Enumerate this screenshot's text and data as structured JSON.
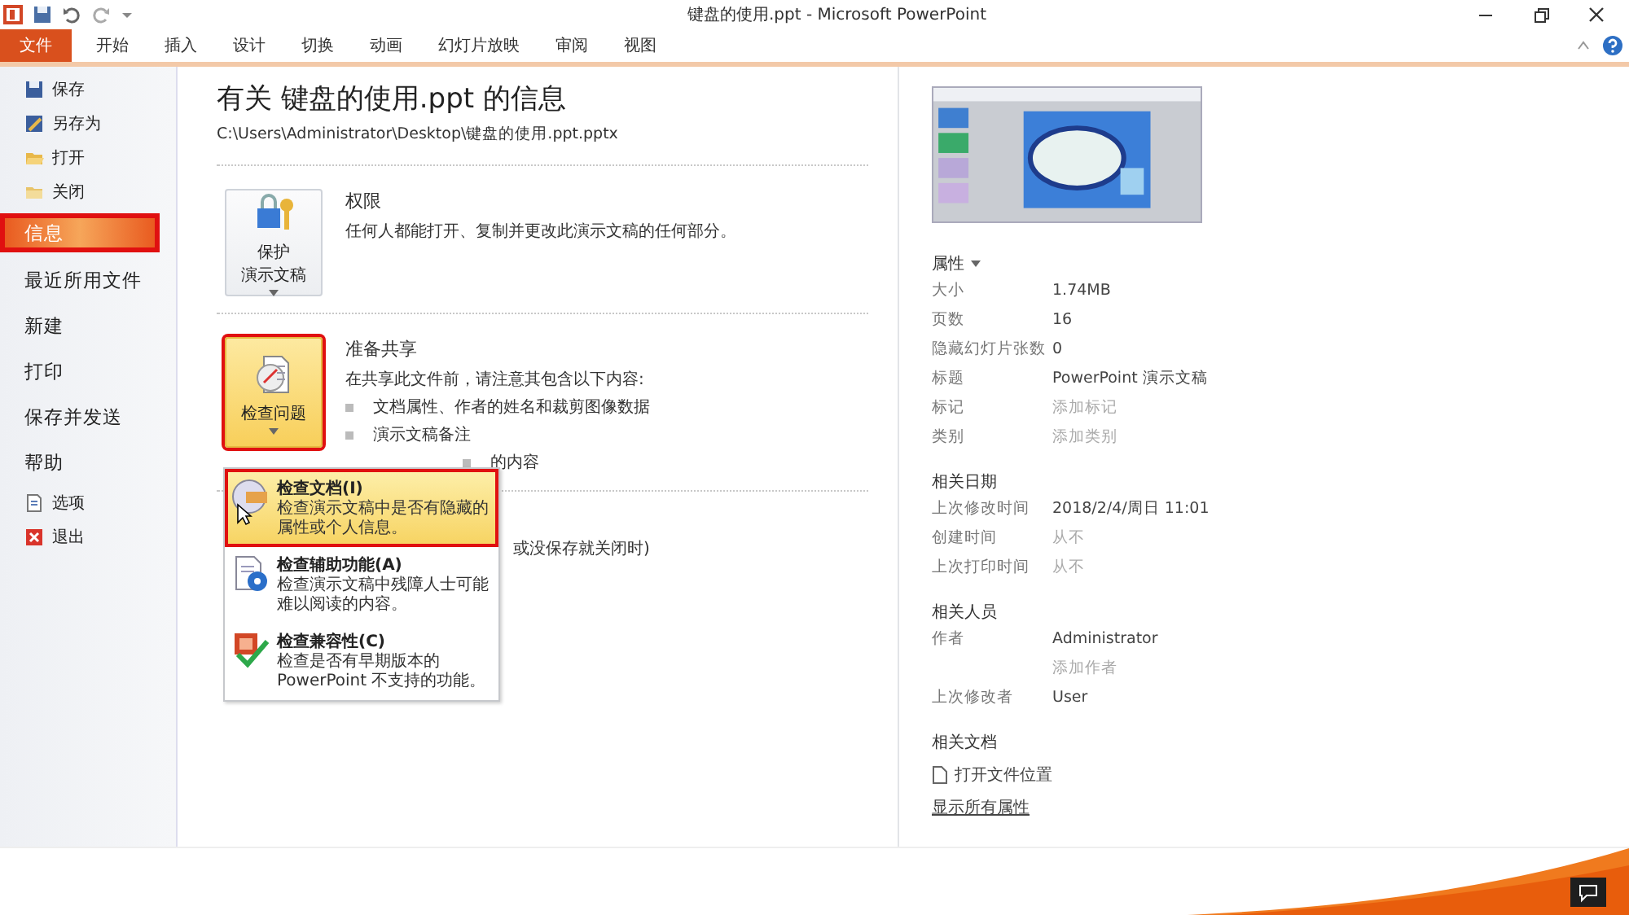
{
  "window": {
    "title": "键盘的使用.ppt - Microsoft PowerPoint"
  },
  "ribbon_tabs": [
    {
      "label": "文件",
      "selected": true
    },
    {
      "label": "开始",
      "selected": false
    },
    {
      "label": "插入",
      "selected": false
    },
    {
      "label": "设计",
      "selected": false
    },
    {
      "label": "切换",
      "selected": false
    },
    {
      "label": "动画",
      "selected": false
    },
    {
      "label": "幻灯片放映",
      "selected": false
    },
    {
      "label": "审阅",
      "selected": false
    },
    {
      "label": "视图",
      "selected": false
    }
  ],
  "backstage_menu": [
    {
      "label": "保存",
      "kind": "command",
      "selected": false,
      "annotated": false
    },
    {
      "label": "另存为",
      "kind": "command",
      "selected": false,
      "annotated": false
    },
    {
      "label": "打开",
      "kind": "command",
      "selected": false,
      "annotated": false
    },
    {
      "label": "关闭",
      "kind": "command",
      "selected": false,
      "annotated": false
    },
    {
      "label": "信息",
      "kind": "page",
      "selected": true,
      "annotated": true
    },
    {
      "label": "最近所用文件",
      "kind": "page",
      "selected": false,
      "annotated": false
    },
    {
      "label": "新建",
      "kind": "page",
      "selected": false,
      "annotated": false
    },
    {
      "label": "打印",
      "kind": "page",
      "selected": false,
      "annotated": false
    },
    {
      "label": "保存并发送",
      "kind": "page",
      "selected": false,
      "annotated": false
    },
    {
      "label": "帮助",
      "kind": "page",
      "selected": false,
      "annotated": false
    },
    {
      "label": "选项",
      "kind": "command",
      "selected": false,
      "annotated": false
    },
    {
      "label": "退出",
      "kind": "command",
      "selected": false,
      "annotated": false
    }
  ],
  "info": {
    "title": "有关 键盘的使用.ppt 的信息",
    "path": "C:\\Users\\Administrator\\Desktop\\键盘的使用.ppt.pptx",
    "sections": [
      {
        "button": {
          "label_lines": [
            "保护",
            "演示文稿"
          ],
          "pressed": false,
          "annotated": false
        },
        "heading": "权限",
        "description": "任何人都能打开、复制并更改此演示文稿的任何部分。"
      },
      {
        "button": {
          "label_lines": [
            "检查问题"
          ],
          "pressed": true,
          "annotated": true
        },
        "heading": "准备共享",
        "description": "在共享此文件前，请注意其包含以下内容:",
        "bullets": [
          "文档属性、作者的姓名和裁剪图像数据",
          "演示文稿备注",
          "的内容"
        ]
      },
      {
        "fragment": "或没保存就关闭时)"
      }
    ]
  },
  "check_menu": [
    {
      "title": "检查文档(I)",
      "description": "检查演示文稿中是否有隐藏的属性或个人信息。",
      "selected": true,
      "annotated": true
    },
    {
      "title": "检查辅助功能(A)",
      "description": "检查演示文稿中残障人士可能难以阅读的内容。",
      "selected": false,
      "annotated": false
    },
    {
      "title": "检查兼容性(C)",
      "description": "检查是否有早期版本的PowerPoint 不支持的功能。",
      "selected": false,
      "annotated": false
    }
  ],
  "properties_panel": {
    "heading": "属性",
    "groups": [
      {
        "rows": [
          {
            "label": "大小",
            "values": [
              {
                "text": "1.74MB",
                "muted": false
              }
            ]
          },
          {
            "label": "页数",
            "values": [
              {
                "text": "16",
                "muted": false
              }
            ]
          },
          {
            "label": "隐藏幻灯片张数",
            "values": [
              {
                "text": "0",
                "muted": false
              }
            ]
          },
          {
            "label": "标题",
            "values": [
              {
                "text": "PowerPoint 演示文稿",
                "muted": false
              }
            ]
          },
          {
            "label": "标记",
            "values": [
              {
                "text": "添加标记",
                "muted": true
              }
            ]
          },
          {
            "label": "类别",
            "values": [
              {
                "text": "添加类别",
                "muted": true
              }
            ]
          }
        ]
      },
      {
        "heading": "相关日期",
        "rows": [
          {
            "label": "上次修改时间",
            "values": [
              {
                "text": "2018/2/4/周日 11:01",
                "muted": false
              }
            ]
          },
          {
            "label": "创建时间",
            "values": [
              {
                "text": "从不",
                "muted": true
              }
            ]
          },
          {
            "label": "上次打印时间",
            "values": [
              {
                "text": "从不",
                "muted": true
              }
            ]
          }
        ]
      },
      {
        "heading": "相关人员",
        "rows": [
          {
            "label": "作者",
            "values": [
              {
                "text": "Administrator",
                "muted": false
              },
              {
                "text": "添加作者",
                "muted": true
              }
            ]
          },
          {
            "label": "上次修改者",
            "values": [
              {
                "text": "User",
                "muted": false
              }
            ]
          }
        ]
      }
    ],
    "related_documents": {
      "heading": "相关文档",
      "open_location": "打开文件位置",
      "show_all": "显示所有属性"
    }
  }
}
